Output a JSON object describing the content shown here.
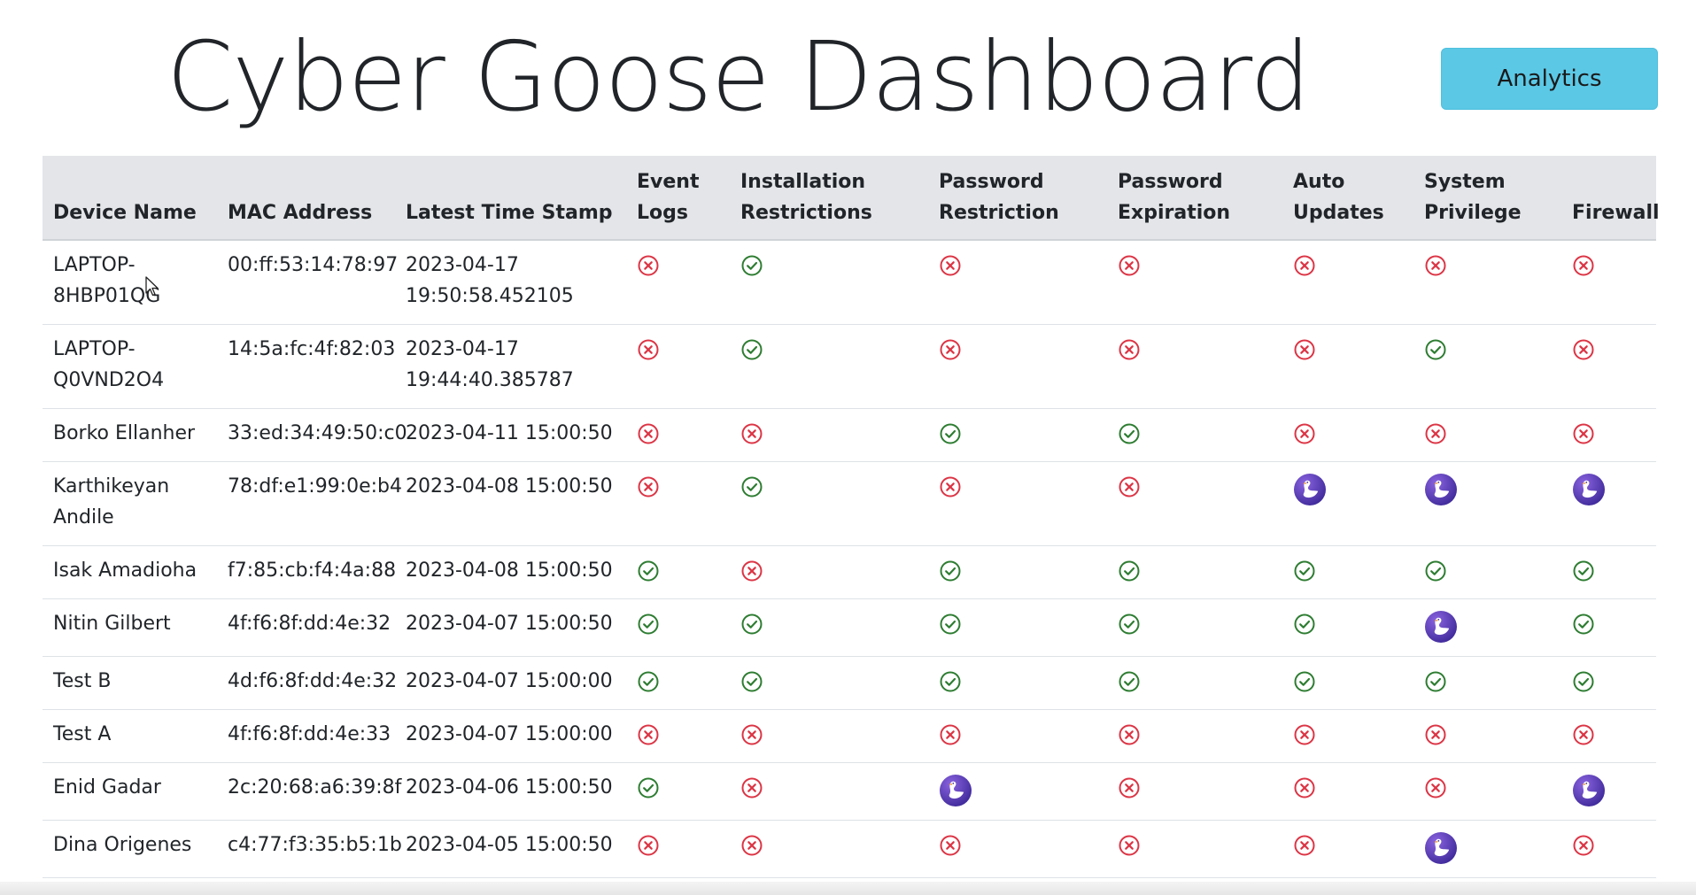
{
  "page": {
    "title": "Cyber Goose Dashboard",
    "analytics_label": "Analytics"
  },
  "colors": {
    "pass": "#2e7d32",
    "fail": "#dc3545",
    "goose_bg": "#6a3ec2",
    "button_bg": "#5bc8e6",
    "header_bg": "#e3e5e8"
  },
  "table": {
    "columns": [
      "Device Name",
      "MAC Address",
      "Latest Time Stamp",
      "Event Logs",
      "Installation Restrictions",
      "Password Restriction",
      "Password Expiration",
      "Auto Updates",
      "System Privilege",
      "Firewall"
    ],
    "status_legend": {
      "pass": "check-circle-icon",
      "fail": "x-circle-icon",
      "goose": "goose-icon"
    },
    "rows": [
      {
        "device": "LAPTOP-8HBP01QG",
        "mac": "00:ff:53:14:78:97",
        "timestamp": "2023-04-17 19:50:58.452105",
        "status": [
          "fail",
          "pass",
          "fail",
          "fail",
          "fail",
          "fail",
          "fail"
        ]
      },
      {
        "device": "LAPTOP-Q0VND2O4",
        "mac": "14:5a:fc:4f:82:03",
        "timestamp": "2023-04-17 19:44:40.385787",
        "status": [
          "fail",
          "pass",
          "fail",
          "fail",
          "fail",
          "pass",
          "fail"
        ]
      },
      {
        "device": "Borko Ellanher",
        "mac": "33:ed:34:49:50:c0",
        "timestamp": "2023-04-11 15:00:50",
        "status": [
          "fail",
          "fail",
          "pass",
          "pass",
          "fail",
          "fail",
          "fail"
        ]
      },
      {
        "device": "Karthikeyan Andile",
        "mac": "78:df:e1:99:0e:b4",
        "timestamp": "2023-04-08 15:00:50",
        "status": [
          "fail",
          "pass",
          "fail",
          "fail",
          "goose",
          "goose",
          "goose"
        ]
      },
      {
        "device": "Isak Amadioha",
        "mac": "f7:85:cb:f4:4a:88",
        "timestamp": "2023-04-08 15:00:50",
        "status": [
          "pass",
          "fail",
          "pass",
          "pass",
          "pass",
          "pass",
          "pass"
        ]
      },
      {
        "device": "Nitin Gilbert",
        "mac": "4f:f6:8f:dd:4e:32",
        "timestamp": "2023-04-07 15:00:50",
        "status": [
          "pass",
          "pass",
          "pass",
          "pass",
          "pass",
          "goose",
          "pass"
        ]
      },
      {
        "device": "Test B",
        "mac": "4d:f6:8f:dd:4e:32",
        "timestamp": "2023-04-07 15:00:00",
        "status": [
          "pass",
          "pass",
          "pass",
          "pass",
          "pass",
          "pass",
          "pass"
        ]
      },
      {
        "device": "Test A",
        "mac": "4f:f6:8f:dd:4e:33",
        "timestamp": "2023-04-07 15:00:00",
        "status": [
          "fail",
          "fail",
          "fail",
          "fail",
          "fail",
          "fail",
          "fail"
        ]
      },
      {
        "device": "Enid Gadar",
        "mac": "2c:20:68:a6:39:8f",
        "timestamp": "2023-04-06 15:00:50",
        "status": [
          "pass",
          "fail",
          "goose",
          "fail",
          "fail",
          "fail",
          "goose"
        ]
      },
      {
        "device": "Dina Origenes",
        "mac": "c4:77:f3:35:b5:1b",
        "timestamp": "2023-04-05 15:00:50",
        "status": [
          "fail",
          "fail",
          "fail",
          "fail",
          "fail",
          "goose",
          "fail"
        ]
      }
    ]
  }
}
